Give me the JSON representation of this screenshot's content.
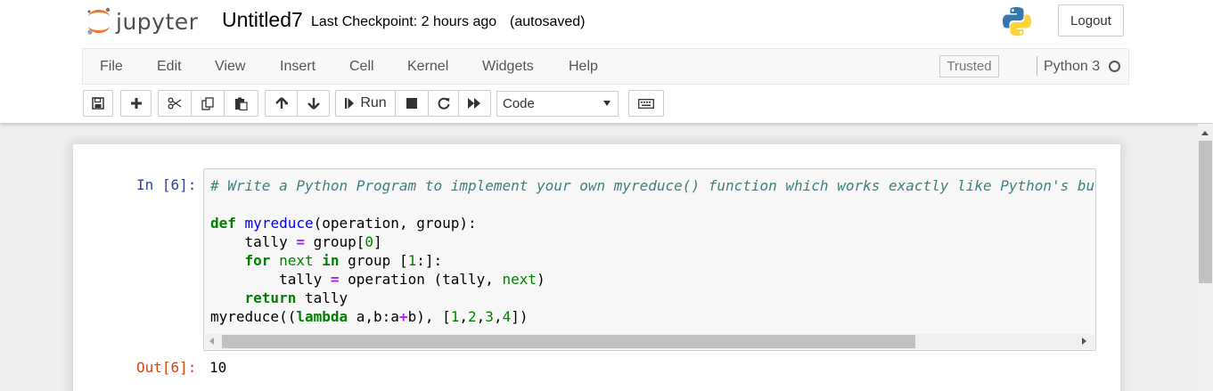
{
  "header": {
    "logo_text": "jupyter",
    "notebook_name": "Untitled7",
    "checkpoint": "Last Checkpoint: 2 hours ago",
    "autosave": "(autosaved)",
    "logout": "Logout",
    "python_logo_icon": "python-logo-icon"
  },
  "menu": {
    "items": [
      "File",
      "Edit",
      "View",
      "Insert",
      "Cell",
      "Kernel",
      "Widgets",
      "Help"
    ],
    "trusted": "Trusted",
    "kernel": "Python 3"
  },
  "toolbar": {
    "run_label": "Run",
    "cell_type": "Code",
    "icons": [
      "save-icon",
      "plus-icon",
      "cut-icon",
      "copy-icon",
      "paste-icon",
      "arrow-up-icon",
      "arrow-down-icon",
      "run-icon",
      "stop-icon",
      "restart-icon",
      "fast-forward-icon",
      "keyboard-icon"
    ]
  },
  "cell": {
    "in_prompt": "In [6]:",
    "out_prompt": "Out[6]:",
    "code_lines": [
      "# Write a Python Program to implement your own myreduce() function which works exactly like Python's bu",
      "",
      "def myreduce(operation, group):",
      "    tally = group[0]",
      "    for next in group [1:]:",
      "        tally = operation (tally, next)",
      "    return tally",
      "myreduce((lambda a,b:a+b), [1,2,3,4])"
    ],
    "output": "10"
  },
  "colors": {
    "in_prompt": "#303f9f",
    "out_prompt": "#d84315",
    "logo_orange": "#f37726"
  }
}
